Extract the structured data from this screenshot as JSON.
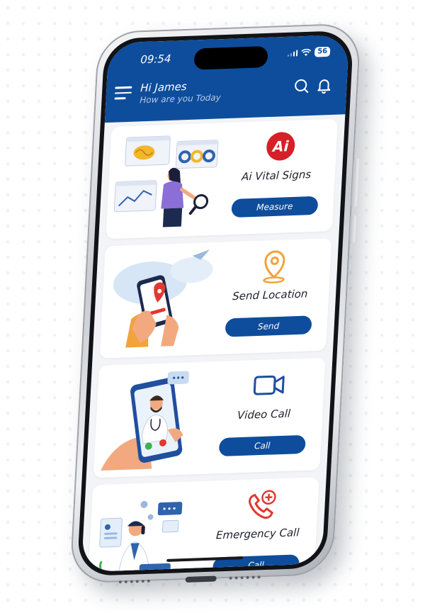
{
  "status": {
    "time": "09:54",
    "battery": "56"
  },
  "header": {
    "greeting": "Hi James",
    "subtitle": "How are you Today"
  },
  "cards": [
    {
      "id": "vital-signs",
      "icon": "ai-logo-icon",
      "title": "Ai Vital Signs",
      "button": "Measure"
    },
    {
      "id": "location",
      "icon": "location-pin-icon",
      "title": "Send Location",
      "button": "Send"
    },
    {
      "id": "video",
      "icon": "video-camera-icon",
      "title": "Video Call",
      "button": "Call"
    },
    {
      "id": "emergency",
      "icon": "emergency-phone-icon",
      "title": "Emergency Call",
      "button": "Call"
    }
  ],
  "colors": {
    "primary": "#0e4d9c",
    "ai_red": "#d62027",
    "location_orange": "#f2a33a",
    "video_blue": "#1f4f9e",
    "emergency_red": "#e0392f",
    "illustration_blue": "#2f63ad",
    "illustration_skin": "#f2a97f"
  }
}
